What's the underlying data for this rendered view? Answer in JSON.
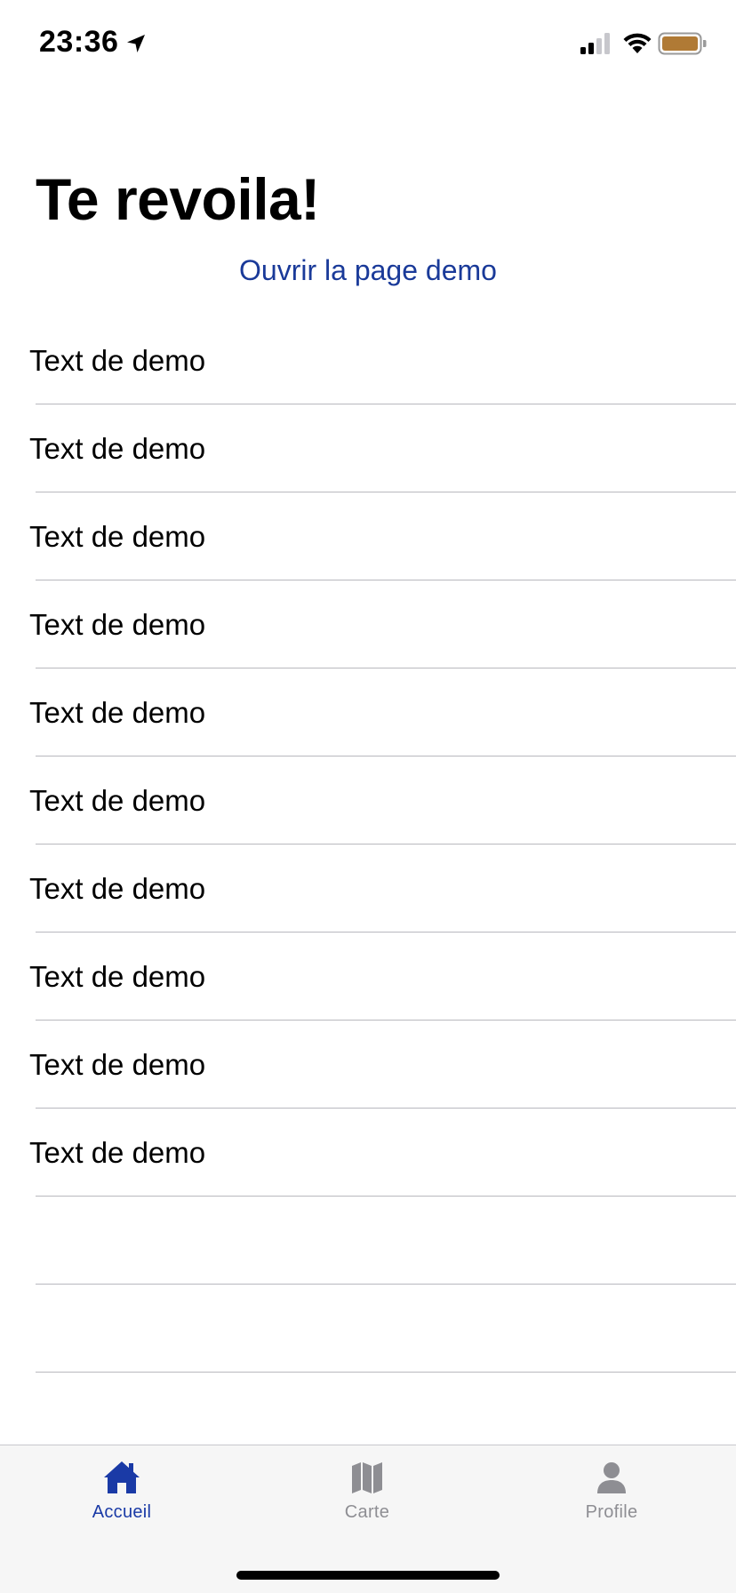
{
  "status_bar": {
    "time": "23:36"
  },
  "header": {
    "title": "Te revoila!",
    "demo_link": "Ouvrir la page demo"
  },
  "list": {
    "items": [
      {
        "label": "Text de demo"
      },
      {
        "label": "Text de demo"
      },
      {
        "label": "Text de demo"
      },
      {
        "label": "Text de demo"
      },
      {
        "label": "Text de demo"
      },
      {
        "label": "Text de demo"
      },
      {
        "label": "Text de demo"
      },
      {
        "label": "Text de demo"
      },
      {
        "label": "Text de demo"
      },
      {
        "label": "Text de demo"
      },
      {
        "label": ""
      },
      {
        "label": ""
      }
    ]
  },
  "tab_bar": {
    "tabs": [
      {
        "label": "Accueil",
        "icon": "home-icon",
        "active": true
      },
      {
        "label": "Carte",
        "icon": "map-icon",
        "active": false
      },
      {
        "label": "Profile",
        "icon": "person-icon",
        "active": false
      }
    ]
  },
  "colors": {
    "accent": "#1a3aa6",
    "inactive": "#8e8e93",
    "battery": "#b07a35"
  }
}
